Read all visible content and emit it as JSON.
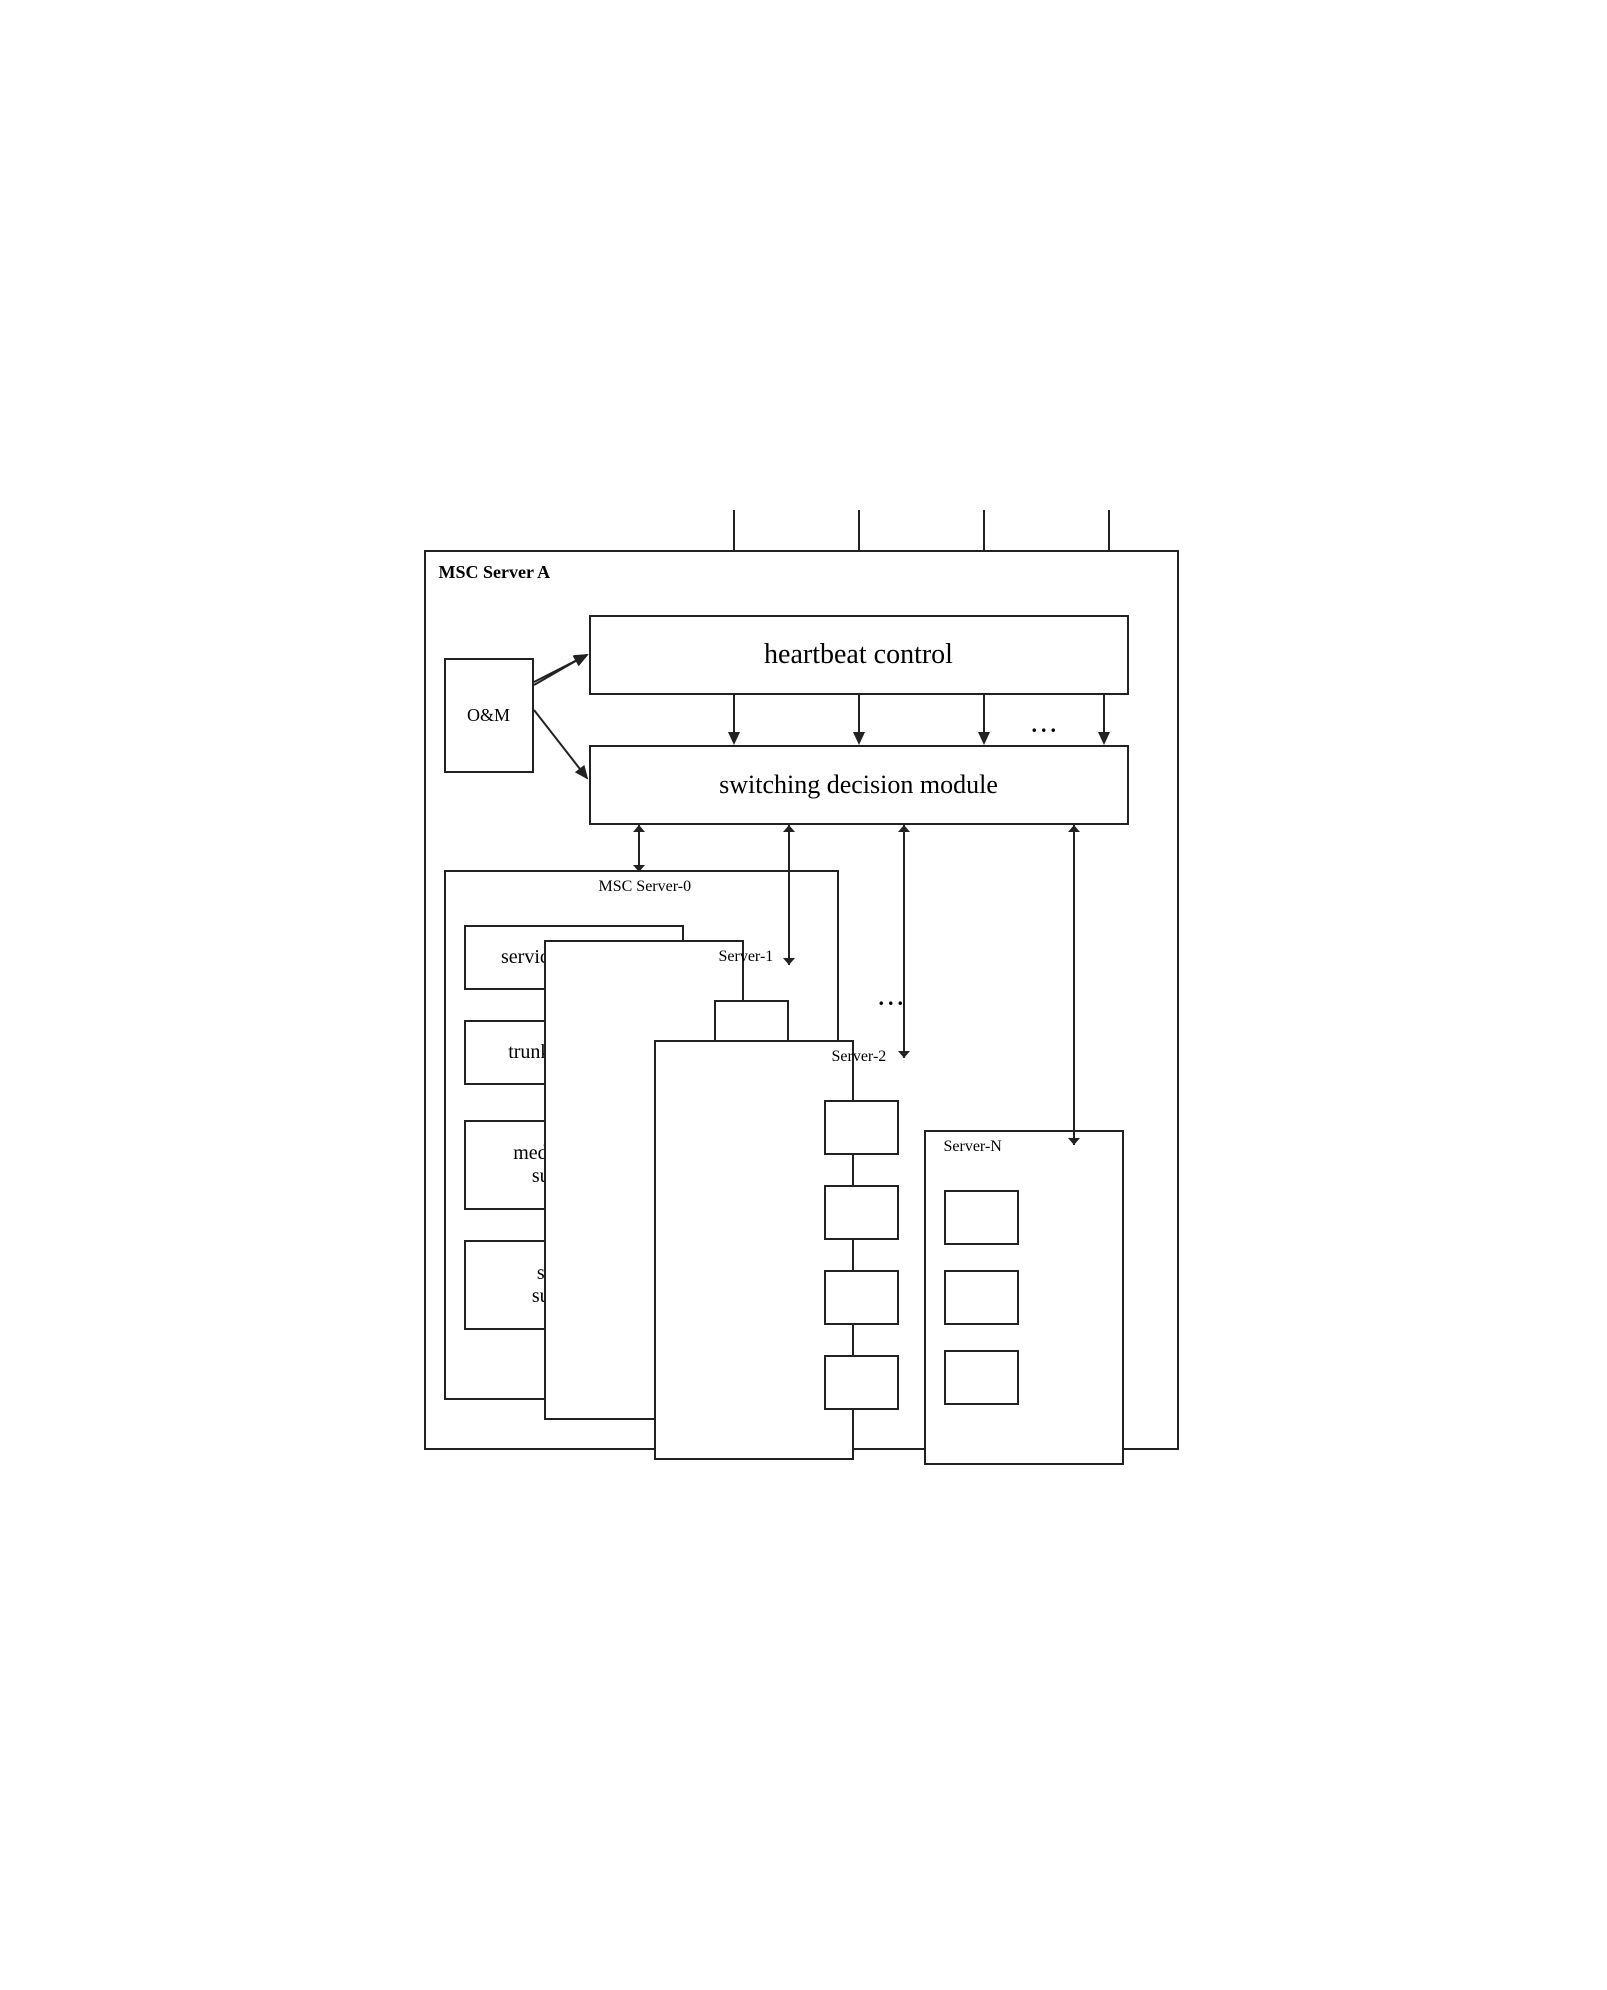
{
  "diagram": {
    "title": "MSC Server A",
    "heartbeat": {
      "label": "heartbeat control"
    },
    "switching": {
      "label": "switching decision module"
    },
    "om": {
      "label": "O&M"
    },
    "server0": {
      "label": "MSC Server-0",
      "subsystems": [
        {
          "label": "service subsystem"
        },
        {
          "label": "trunk subsystem"
        },
        {
          "label": "media gateway\nsubsystem"
        },
        {
          "label": "signaling\nsubsystem"
        }
      ]
    },
    "servers": [
      {
        "label": "Server-1"
      },
      {
        "label": "Server-2"
      },
      {
        "label": "Server-N"
      }
    ],
    "dots": "..."
  }
}
